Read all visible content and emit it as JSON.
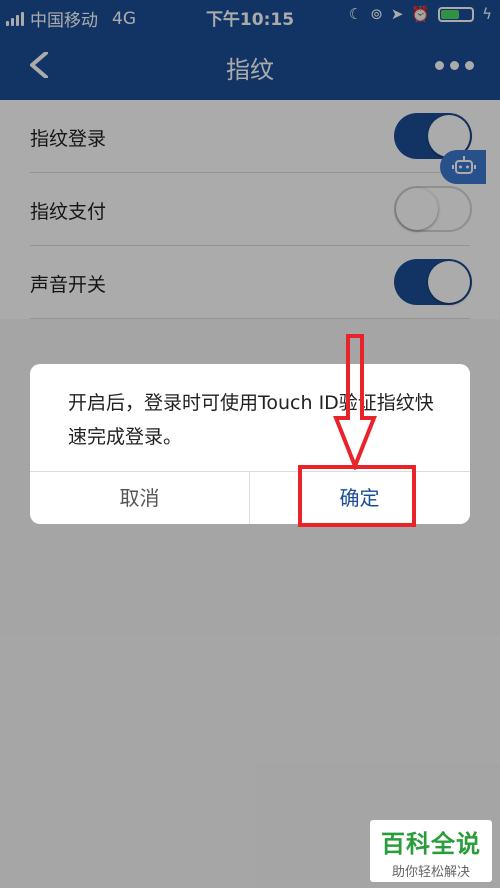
{
  "status_bar": {
    "carrier": "中国移动",
    "network": "4G",
    "time": "下午10:15",
    "battery_level": 0.55
  },
  "navbar": {
    "title": "指纹"
  },
  "settings": [
    {
      "label": "指纹登录",
      "on": true
    },
    {
      "label": "指纹支付",
      "on": false
    },
    {
      "label": "声音开关",
      "on": true
    }
  ],
  "dialog": {
    "message": "开启后，登录时可使用Touch ID验证指纹快速完成登录。",
    "cancel_label": "取消",
    "confirm_label": "确定"
  },
  "watermark": {
    "brand": "百科全说",
    "slogan": "助你轻松解决"
  },
  "colors": {
    "primary": "#1c4e95",
    "annotation": "#e8232a",
    "watermark_green": "#2a9d3b"
  }
}
